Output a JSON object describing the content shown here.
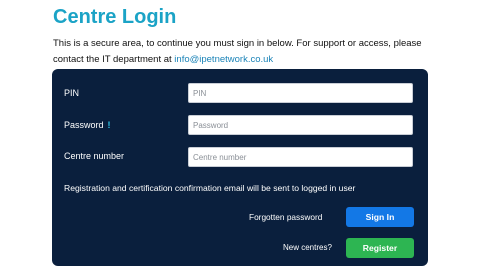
{
  "page": {
    "title": "Centre Login",
    "intro_text": "This is a secure area, to continue you must sign in below. For support or access, please contact the IT department at ",
    "support_email": "info@ipetnetwork.co.uk"
  },
  "form": {
    "pin": {
      "label": "PIN",
      "placeholder": "PIN",
      "value": ""
    },
    "password": {
      "label": "Password",
      "info_marker": "!",
      "placeholder": "Password",
      "value": ""
    },
    "centre_number": {
      "label": "Centre number",
      "placeholder": "Centre number",
      "value": ""
    },
    "notice": "Registration and certification confirmation email will be sent to logged in user",
    "forgotten_password_label": "Forgotten password",
    "sign_in_label": "Sign In",
    "new_centres_label": "New centres?",
    "register_label": "Register"
  },
  "colors": {
    "title": "#1ba3c6",
    "panel_bg": "#0a1f3d",
    "sign_in_button": "#1378e6",
    "register_button": "#2db552",
    "info_marker": "#2ec4e8",
    "link": "#1c84b8"
  }
}
